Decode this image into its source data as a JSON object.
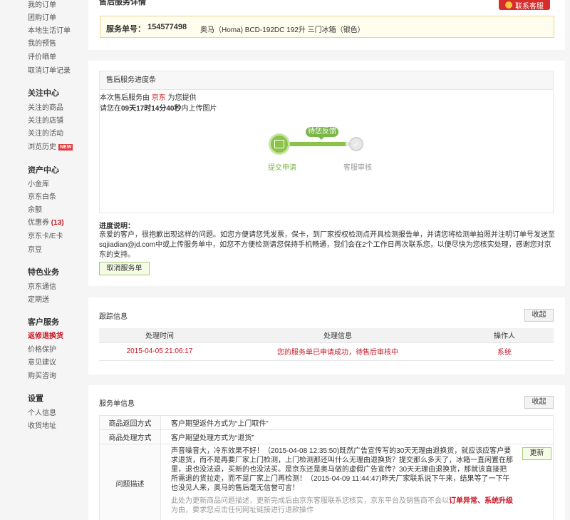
{
  "sidebar": {
    "order_items": [
      "我的订单",
      "团购订单",
      "本地生活订单",
      "我的预售",
      "评价晒单",
      "取消订单记录"
    ],
    "follow": {
      "title": "关注中心",
      "items": [
        "关注的商品",
        "关注的店铺",
        "关注的活动"
      ],
      "history": "浏览历史",
      "new_badge": "NEW"
    },
    "assets": {
      "title": "资产中心",
      "items": [
        "小金库",
        "京东白条",
        "余额"
      ],
      "coupon": "优惠券",
      "coupon_count": "(13)",
      "items2": [
        "京东卡/E卡",
        "京豆"
      ]
    },
    "special": {
      "title": "特色业务",
      "items": [
        "京东通信",
        "定期送"
      ]
    },
    "service": {
      "title": "客户服务",
      "active": "返修退换货",
      "items": [
        "价格保护",
        "意见建议",
        "购买咨询"
      ]
    },
    "settings": {
      "title": "设置",
      "items": [
        "个人信息",
        "收货地址"
      ]
    }
  },
  "top": {
    "title": "售后服务详情",
    "cs_button": "联系客服",
    "service_label": "服务单号：",
    "service_no": "154577498",
    "product": "奥马（Homa) BCD-192DC 192升 三门冰箱（银色）"
  },
  "progress": {
    "header": "售后服务进度条",
    "line1_pre": "本次售后服务由 ",
    "line1_link": "京东",
    "line1_post": " 为您提供",
    "line2_pre": "请您在",
    "days": "09",
    "days_unit": "天",
    "hours": "17",
    "hours_unit": "时",
    "minutes": "14",
    "minutes_unit": "分",
    "seconds": "40",
    "seconds_unit": "秒",
    "line2_post": "内上传图片",
    "tip": "待您反馈",
    "step1": "提交申请",
    "step2": "客服审核",
    "check_glyph": "✓",
    "note_title": "进度说明：",
    "note_text": "亲爱的客户，很抱歉出现这样的问题。如您方便请您凭发票，保卡，到厂家授权检测点开具检测报告单，并请您将检测单拍照并注明订单号发送至sqjiadian@jd.com中或上传服务单中，如您不方便检测请您保持手机畅通，我们会在2个工作日再次联系您，以便尽快为您核实处理，感谢您对京东的支持。",
    "cancel_button": "取消服务单"
  },
  "track": {
    "title": "跟踪信息",
    "fold_button": "收起",
    "columns": [
      "处理时间",
      "处理信息",
      "操作人"
    ],
    "rows": [
      {
        "time": "2015-04-05 21:06:17",
        "info": "您的服务单已申请成功，待售后审核中",
        "operator": "系统"
      }
    ]
  },
  "info": {
    "title": "服务单信息",
    "fold_button": "收起",
    "rows": [
      {
        "key": "商品返回方式",
        "value": "客户期望返件方式为“上门取件”"
      },
      {
        "key": "商品处理方式",
        "value": "客户期望处理方式为“退货”"
      }
    ],
    "desc_key": "问题描述",
    "desc_text": "声音噪音大，冷东效果不好！（2015-04-08 12:35:50)既然广告宣传写的30天无理由退换货，就应该应客户要求退货，而不是再要厂家上门检测，上门检测那还叫什么无理由退换货？提交那么多天了，冰箱一直闲置在那里，退也没法退，买新的也没法买。是京东还是奥马做的虚假广告宣传？30天无理由退换货，那就该直接把所需退的货拉走，而不是厂家上门再检测！（2015-04-09 11:44:47)昨天厂家联系说下午来，结果等了一下午也没见人来，奥马的售后毫无信誉可言！",
    "desc_sub_pre": "此处为更新商品问题描述，更新完成后由京东客服联系您核实，京东平台及销售商不会以",
    "desc_sub_red": "订单异常、系统升级",
    "desc_sub_post": "为由，要求您点击任何网址链接进行退款操作",
    "update_button": "更新"
  }
}
